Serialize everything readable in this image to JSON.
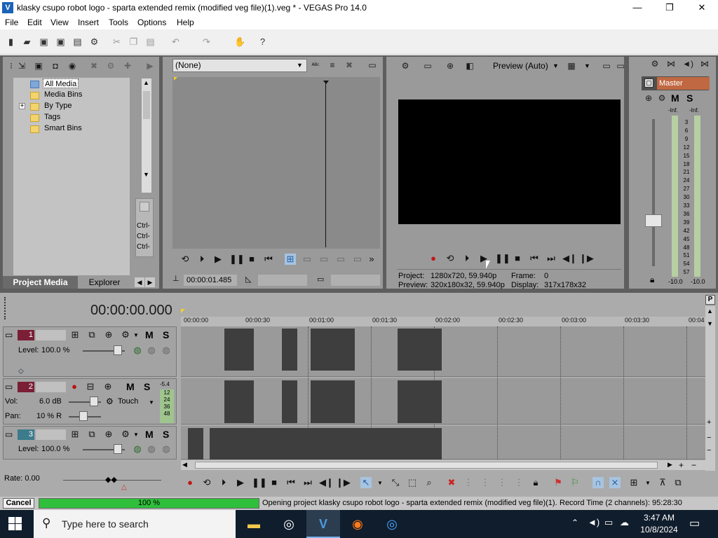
{
  "window": {
    "title": "klasky csupo robot logo - sparta extended remix (modified veg file)(1).veg * - VEGAS Pro 14.0",
    "minimize": "—",
    "maximize": "❐",
    "close": "✕"
  },
  "menu": {
    "items": [
      "File",
      "Edit",
      "View",
      "Insert",
      "Tools",
      "Options",
      "Help"
    ]
  },
  "project_media": {
    "tree": [
      "All Media",
      "Media Bins",
      "By Type",
      "Tags",
      "Smart Bins"
    ],
    "expand_glyph": "+",
    "tabs": [
      "Project Media",
      "Explorer"
    ],
    "ctrl_labels": [
      "Ctrl-",
      "Ctrl-",
      "Ctrl-"
    ]
  },
  "trimmer": {
    "select_value": "(None)",
    "timecode": "00:00:01.485"
  },
  "preview": {
    "mode": "Preview (Auto)",
    "project_label": "Project:",
    "project_value": "1280x720, 59.940p",
    "preview_label": "Preview:",
    "preview_value": "320x180x32, 59.940p",
    "frame_label": "Frame:",
    "frame_value": "0",
    "display_label": "Display:",
    "display_value": "317x178x32"
  },
  "master": {
    "label": "Master",
    "m": "M",
    "s": "S",
    "inf_left": "-Inf.",
    "inf_right": "-Inf.",
    "scale": [
      "3",
      "6",
      "9",
      "12",
      "15",
      "18",
      "21",
      "24",
      "27",
      "30",
      "33",
      "36",
      "39",
      "42",
      "45",
      "48",
      "51",
      "54",
      "57"
    ],
    "bottom_left": "-10.0",
    "bottom_right": "-10.0"
  },
  "timeline": {
    "timecode": "00:00:00.000",
    "ruler": [
      "00:00:00",
      "00:00:30",
      "00:01:00",
      "00:01:30",
      "00:02:00",
      "00:02:30",
      "00:03:00",
      "00:03:30",
      "00:04"
    ],
    "tracks": [
      {
        "number": "1",
        "level_label": "Level:",
        "level_value": "100.0 %",
        "m": "M",
        "s": "S"
      },
      {
        "number": "2",
        "vol_label": "Vol:",
        "vol_value": "6.0 dB",
        "pan_label": "Pan:",
        "pan_value": "10 % R",
        "touch": "Touch",
        "m": "M",
        "s": "S",
        "meter": [
          "-5.4",
          "12",
          "24",
          "36",
          "48"
        ]
      },
      {
        "number": "3",
        "level_label": "Level:",
        "level_value": "100.0 %",
        "m": "M",
        "s": "S"
      }
    ],
    "rate": "Rate: 0.00",
    "p_button": "P"
  },
  "status": {
    "cancel": "Cancel",
    "progress": 100,
    "progress_text": "100 %",
    "message": "Opening project klasky csupo robot logo - sparta extended remix (modified veg file)(1).",
    "record_time": "Record Time (2 channels): 95:28:30"
  },
  "taskbar": {
    "search_placeholder": "Type here to search",
    "time": "3:47 AM",
    "date": "10/8/2024"
  },
  "colors": {
    "panel": "#9a9a9a",
    "dark": "#5e5e5e",
    "progress": "#2fbf3b",
    "taskbar": "#101d2c"
  }
}
